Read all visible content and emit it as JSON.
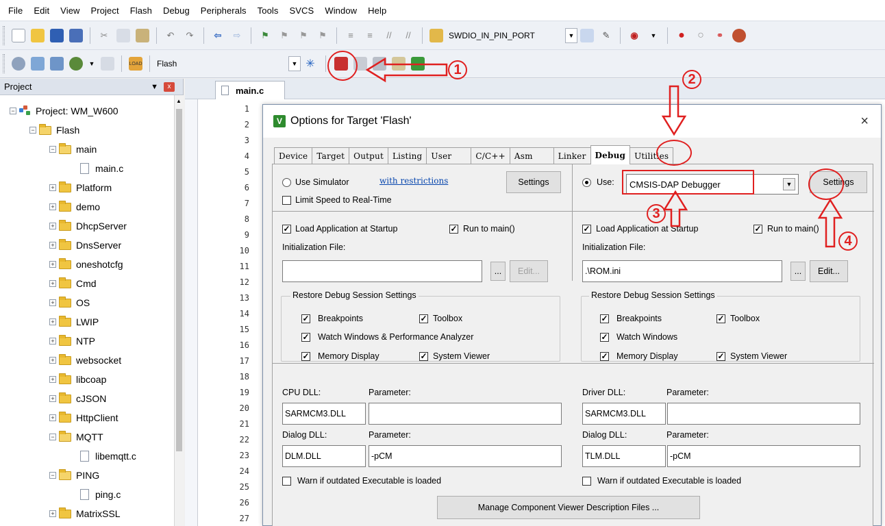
{
  "menu": [
    "File",
    "Edit",
    "View",
    "Project",
    "Flash",
    "Debug",
    "Peripherals",
    "Tools",
    "SVCS",
    "Window",
    "Help"
  ],
  "toolbar1": {
    "target_combo": "SWDIO_IN_PIN_PORT"
  },
  "toolbar2": {
    "target_combo": "Flash"
  },
  "project": {
    "title": "Project",
    "pin": "▼",
    "close": "x",
    "tree": [
      "Project: WM_W600",
      "Flash",
      "main",
      "main.c",
      "Platform",
      "demo",
      "DhcpServer",
      "DnsServer",
      "oneshotcfg",
      "Cmd",
      "OS",
      "LWIP",
      "NTP",
      "websocket",
      "libcoap",
      "cJSON",
      "HttpClient",
      "MQTT",
      "libemqtt.c",
      "PING",
      "ping.c",
      "MatrixSSL"
    ]
  },
  "editor": {
    "tab": "main.c",
    "lines": [
      "1",
      "2",
      "3",
      "4",
      "5",
      "6",
      "7",
      "8",
      "9",
      "10",
      "11",
      "12",
      "13",
      "14",
      "15",
      "16",
      "17",
      "18",
      "19",
      "20",
      "21",
      "22",
      "23",
      "24",
      "25",
      "26",
      "27"
    ]
  },
  "dialog": {
    "title": "Options for Target 'Flash'",
    "close": "×",
    "tabs": [
      "Device",
      "Target",
      "Output",
      "Listing",
      "User",
      "C/C++",
      "Asm",
      "Linker",
      "Debug",
      "Utilities"
    ],
    "left": {
      "use_simulator": "Use Simulator",
      "with_restrictions": "with restrictions",
      "settings": "Settings",
      "limit_speed": "Limit Speed to Real-Time",
      "load_app": "Load Application at Startup",
      "run_to_main": "Run to main()",
      "init_file_label": "Initialization File:",
      "init_file": "",
      "browse": "...",
      "edit": "Edit...",
      "restore_group": "Restore Debug Session Settings",
      "breakpoints": "Breakpoints",
      "toolbox": "Toolbox",
      "watch": "Watch Windows & Performance Analyzer",
      "memory": "Memory Display",
      "sysviewer": "System Viewer",
      "cpu_dll_label": "CPU DLL:",
      "param_label": "Parameter:",
      "cpu_dll": "SARMCM3.DLL",
      "cpu_param": "",
      "dialog_dll_label": "Dialog DLL:",
      "dialog_dll": "DLM.DLL",
      "dialog_param": "-pCM",
      "warn": "Warn if outdated Executable is loaded"
    },
    "right": {
      "use": "Use:",
      "debugger": "CMSIS-DAP Debugger",
      "settings": "Settings",
      "load_app": "Load Application at Startup",
      "run_to_main": "Run to main()",
      "init_file_label": "Initialization File:",
      "init_file": ".\\ROM.ini",
      "browse": "...",
      "edit": "Edit...",
      "restore_group": "Restore Debug Session Settings",
      "breakpoints": "Breakpoints",
      "toolbox": "Toolbox",
      "watch": "Watch Windows",
      "memory": "Memory Display",
      "sysviewer": "System Viewer",
      "driver_dll_label": "Driver DLL:",
      "param_label": "Parameter:",
      "driver_dll": "SARMCM3.DLL",
      "driver_param": "",
      "dialog_dll_label": "Dialog DLL:",
      "dialog_dll": "TLM.DLL",
      "dialog_param": "-pCM",
      "warn": "Warn if outdated Executable is loaded"
    },
    "manage_button": "Manage Component Viewer Description Files ..."
  },
  "annotations": [
    "1",
    "2",
    "3",
    "4"
  ],
  "colors": {
    "annotation": "#e02020",
    "link": "#0645ad"
  }
}
